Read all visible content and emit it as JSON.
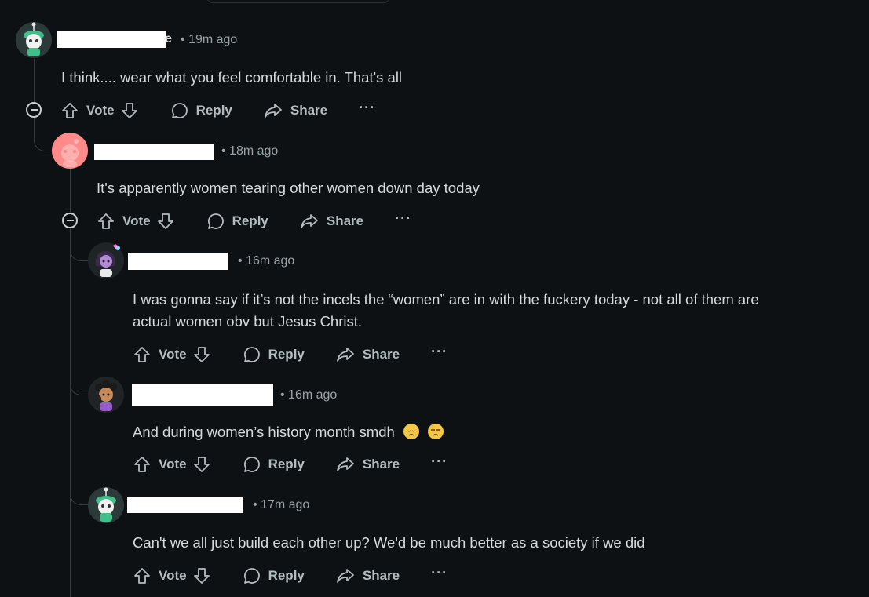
{
  "comments": [
    {
      "time": "• 19m ago",
      "username_tail": "e",
      "text": "I think.... wear what you feel comfortable in. That's all",
      "vote_label": "Vote",
      "reply_label": "Reply",
      "share_label": "Share",
      "more_label": "···"
    },
    {
      "time": "• 18m ago",
      "text": "It's apparently women tearing other women down day today",
      "vote_label": "Vote",
      "reply_label": "Reply",
      "share_label": "Share",
      "more_label": "···"
    },
    {
      "time": "• 16m ago",
      "text_line1": "I was gonna say if it’s not the incels the “women” are in with the fuckery today - not all of them are",
      "text_line2": "actual women obv but Jesus Christ.",
      "vote_label": "Vote",
      "reply_label": "Reply",
      "share_label": "Share",
      "more_label": "···"
    },
    {
      "time": "• 16m ago",
      "text": "And during women’s history month smdh",
      "vote_label": "Vote",
      "reply_label": "Reply",
      "share_label": "Share",
      "more_label": "···"
    },
    {
      "time": "• 17m ago",
      "text": "Can't we all just build each other up? We'd be much better as a society if we did",
      "vote_label": "Vote",
      "reply_label": "Reply",
      "share_label": "Share",
      "more_label": "···"
    }
  ],
  "icons": {
    "upvote": "arrow-up-icon",
    "downvote": "arrow-down-icon",
    "reply": "speech-bubble-icon",
    "share": "share-arrow-icon",
    "collapse": "minus-circle-icon",
    "emoji_1": "disappointed-face-emoji",
    "emoji_2": "unamused-face-emoji"
  },
  "colors": {
    "background": "#0e1113",
    "text": "#d7dadc",
    "meta": "#9aa3a8",
    "action": "#b3bcc1",
    "redaction": "#ffffff"
  }
}
